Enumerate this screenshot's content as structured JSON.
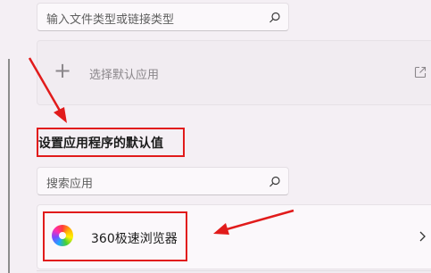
{
  "file_type_search": {
    "placeholder": "输入文件类型或链接类型",
    "icon": "search-icon"
  },
  "default_app": {
    "label": "选择默认应用",
    "plus_icon": "plus-icon",
    "external_icon": "open-external-icon"
  },
  "section": {
    "title": "设置应用程序的默认值"
  },
  "app_search": {
    "placeholder": "搜索应用",
    "icon": "search-icon"
  },
  "apps": [
    {
      "name": "360极速浏览器",
      "icon": "360-browser-icon",
      "chevron": "chevron-right-icon"
    }
  ],
  "colors": {
    "annotation_red": "#e11b1b",
    "background": "#f4eff4"
  }
}
